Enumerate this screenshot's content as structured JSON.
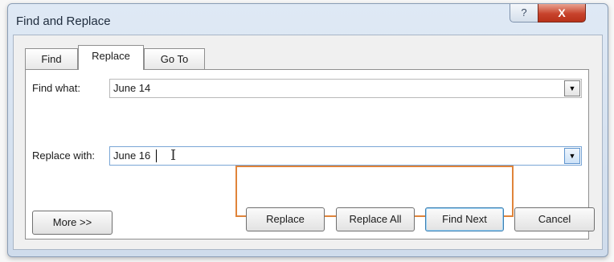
{
  "dialog": {
    "title": "Find and Replace",
    "help_label": "?",
    "close_label": "X"
  },
  "tabs": [
    {
      "label": "Find",
      "active": false
    },
    {
      "label": "Replace",
      "active": true
    },
    {
      "label": "Go To",
      "active": false
    }
  ],
  "find": {
    "label": "Find what:",
    "value": "June 14",
    "dropdown_glyph": "▼"
  },
  "replace": {
    "label": "Replace with:",
    "value": "June 16",
    "dropdown_glyph": "▼"
  },
  "buttons": {
    "more": "More >>",
    "replace": "Replace",
    "replace_all": "Replace All",
    "find_next": "Find Next",
    "cancel": "Cancel"
  },
  "colors": {
    "highlight": "#e0843a",
    "close": "#c8432c"
  },
  "icons": {
    "text_cursor": "text-cursor-icon",
    "dropdown": "chevron-down-icon"
  }
}
